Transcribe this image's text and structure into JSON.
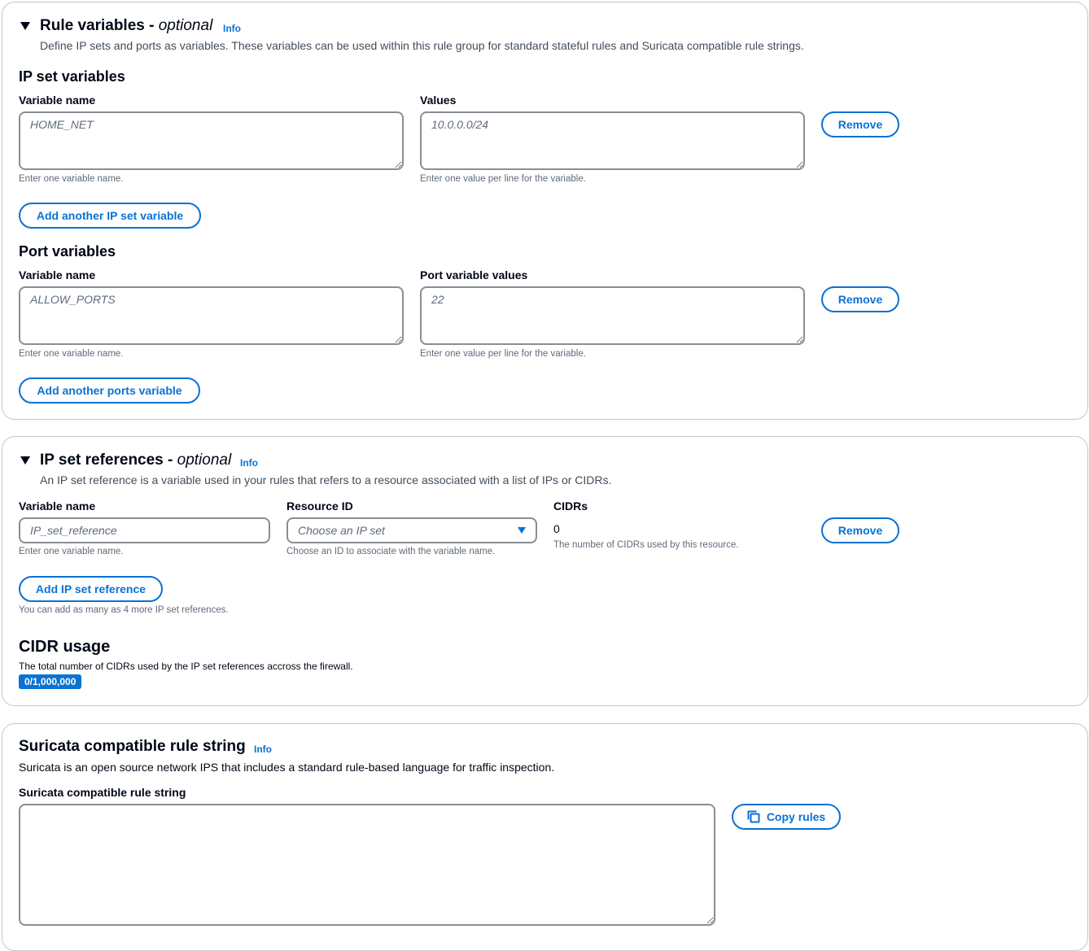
{
  "rule_variables": {
    "title": "Rule variables - ",
    "title_optional": "optional",
    "info": "Info",
    "description": "Define IP sets and ports as variables. These variables can be used within this rule group for standard stateful rules and Suricata compatible rule strings.",
    "ip_set": {
      "heading": "IP set variables",
      "name_label": "Variable name",
      "name_placeholder": "HOME_NET",
      "name_hint": "Enter one variable name.",
      "values_label": "Values",
      "values_placeholder": "10.0.0.0/24",
      "values_hint": "Enter one value per line for the variable.",
      "remove": "Remove",
      "add": "Add another IP set variable"
    },
    "ports": {
      "heading": "Port variables",
      "name_label": "Variable name",
      "name_placeholder": "ALLOW_PORTS",
      "name_hint": "Enter one variable name.",
      "values_label": "Port variable values",
      "values_placeholder": "22",
      "values_hint": "Enter one value per line for the variable.",
      "remove": "Remove",
      "add": "Add another ports variable"
    }
  },
  "ip_set_references": {
    "title": "IP set references - ",
    "title_optional": "optional",
    "info": "Info",
    "description": "An IP set reference is a variable used in your rules that refers to a resource associated with a list of IPs or CIDRs.",
    "name_label": "Variable name",
    "name_placeholder": "IP_set_reference",
    "name_hint": "Enter one variable name.",
    "resource_label": "Resource ID",
    "resource_placeholder": "Choose an IP set",
    "resource_hint": "Choose an ID to associate with the variable name.",
    "cidrs_label": "CIDRs",
    "cidrs_value": "0",
    "cidrs_hint": "The number of CIDRs used by this resource.",
    "remove": "Remove",
    "add": "Add IP set reference",
    "add_hint": "You can add as many as 4 more IP set references.",
    "cidr_usage": {
      "heading": "CIDR usage",
      "description": "The total number of CIDRs used by the IP set references accross the firewall.",
      "badge": "0/1,000,000"
    }
  },
  "suricata": {
    "title": "Suricata compatible rule string",
    "info": "Info",
    "description": "Suricata is an open source network IPS that includes a standard rule-based language for traffic inspection.",
    "field_label": "Suricata compatible rule string",
    "field_value": "",
    "copy": "Copy rules"
  },
  "colors": {
    "accent": "#0972d3",
    "text": "#000716",
    "border": "#8c8c94"
  }
}
